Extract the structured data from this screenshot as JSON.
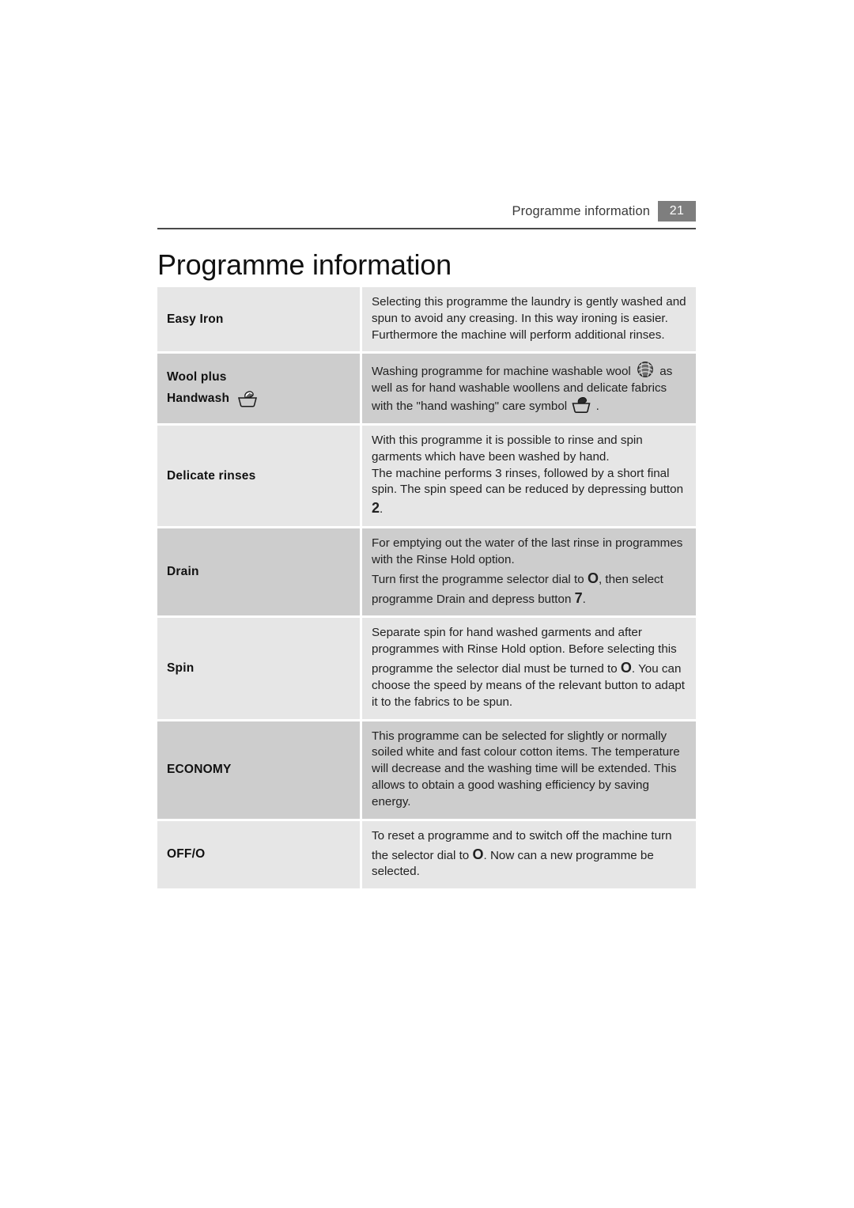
{
  "header": {
    "title": "Programme information",
    "page_number": "21"
  },
  "page_title": "Programme information",
  "icons": {
    "handwash_outline": "handwash-basin-icon",
    "wool": "wool-ball-icon",
    "handwash_solid": "hand-washing-care-symbol-icon"
  },
  "table": {
    "rows": [
      {
        "shade": "light",
        "name_lines": [
          "Easy Iron"
        ],
        "icon_after_line2": null,
        "description": "Selecting this programme the laundry is gently washed and spun to avoid any creasing. In this way ironing is easier. Furthermore the machine will perform additional rinses."
      },
      {
        "shade": "dark",
        "name_lines": [
          "Wool plus",
          "Handwash"
        ],
        "icon_after_line2": "handwash_outline",
        "desc_part1": "Washing programme for machine washable wool",
        "desc_part2": "as well as for hand washable woollens and delicate fabrics with the \"hand washing\" care symbol",
        "desc_part3": "."
      },
      {
        "shade": "light",
        "name_lines": [
          "Delicate rinses"
        ],
        "desc_part1": "With this programme it is possible to rinse and spin garments which have been washed by hand.",
        "desc_part2": "The machine performs 3 rinses, followed by a short final spin. The spin speed can be reduced by depressing button",
        "button": "2",
        "desc_part3": "."
      },
      {
        "shade": "dark",
        "name_lines": [
          "Drain"
        ],
        "desc_part1": "For emptying out the water of the last rinse in programmes with the Rinse Hold option.",
        "desc_part2": "Turn first the programme selector dial to",
        "dial": "O",
        "desc_part3": ", then select programme Drain and depress button",
        "button": "7",
        "desc_part4": "."
      },
      {
        "shade": "light",
        "name_lines": [
          "Spin"
        ],
        "desc_part1": "Separate spin for hand washed garments and after programmes with Rinse Hold option. Before selecting this programme the selector dial must be turned to",
        "dial": "O",
        "desc_part2": ". You can choose the speed by means of the relevant button to adapt it to the fabrics to be spun."
      },
      {
        "shade": "dark",
        "name_lines": [
          "ECONOMY"
        ],
        "description": "This programme can be selected for slightly or normally soiled white and fast colour cotton items. The temperature will decrease and the washing time will be extended. This allows to obtain a good washing efficiency by saving energy."
      },
      {
        "shade": "light",
        "name_lines": [
          "OFF/O"
        ],
        "desc_part1": "To reset a programme and to switch off the machine turn the selector dial to",
        "dial": "O",
        "desc_part2": ". Now can a new programme be selected."
      }
    ]
  }
}
